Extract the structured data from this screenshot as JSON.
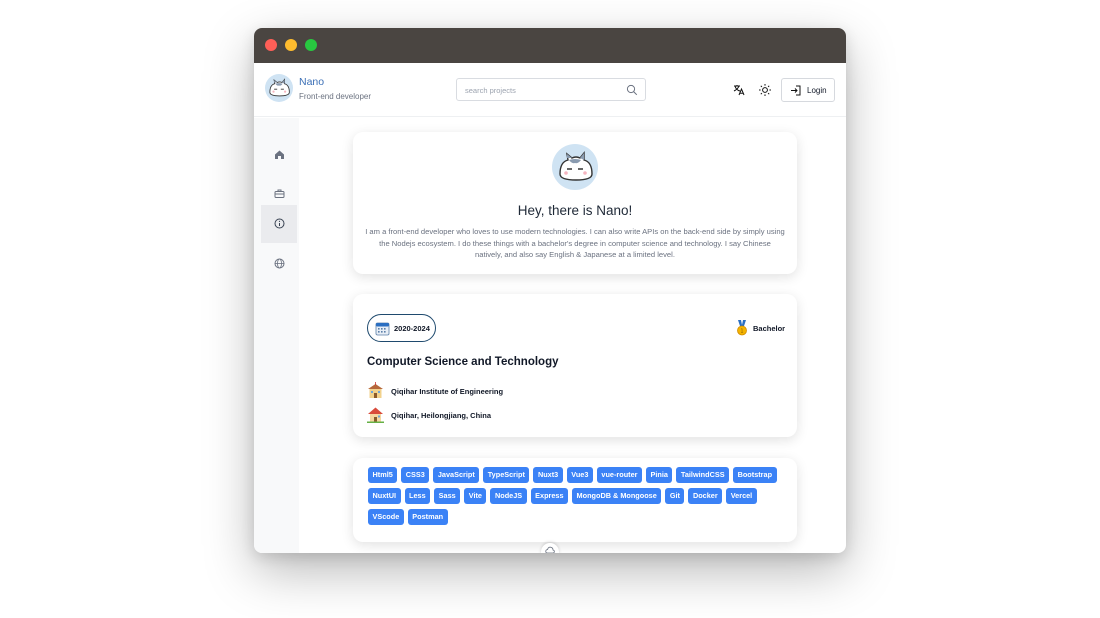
{
  "header": {
    "name": "Nano",
    "subtitle": "Front-end developer",
    "search_placeholder": "search projects",
    "login_label": "Login"
  },
  "sidebar": {
    "items": [
      {
        "icon": "home-icon"
      },
      {
        "icon": "briefcase-icon"
      },
      {
        "icon": "info-icon",
        "active": true
      },
      {
        "icon": "globe-icon"
      }
    ]
  },
  "profile": {
    "greeting": "Hey, there is Nano!",
    "intro": "I am a front-end developer who loves to use modern technologies. I can also write APIs on the back-end side by simply using the Nodejs ecosystem. I do these things with a bachelor's degree in computer science and technology. I say Chinese natively, and also say English & Japanese at a limited level."
  },
  "education": {
    "years": "2020-2024",
    "degree": "Bachelor",
    "major": "Computer Science and Technology",
    "school": "Qiqihar Institute of Engineering",
    "location": "Qiqihar, Heilongjiang, China"
  },
  "skills": [
    "Html5",
    "CSS3",
    "JavaScript",
    "TypeScript",
    "Nuxt3",
    "Vue3",
    "vue-router",
    "Pinia",
    "TailwindCSS",
    "Bootstrap",
    "NuxtUI",
    "Less",
    "Sass",
    "Vite",
    "NodeJS",
    "Express",
    "MongoDB & Mongoose",
    "Git",
    "Docker",
    "Vercel",
    "VScode",
    "Postman"
  ],
  "colors": {
    "accent": "#3b82f6",
    "brand_text": "#3b6fb6",
    "titlebar": "#4a4541"
  }
}
